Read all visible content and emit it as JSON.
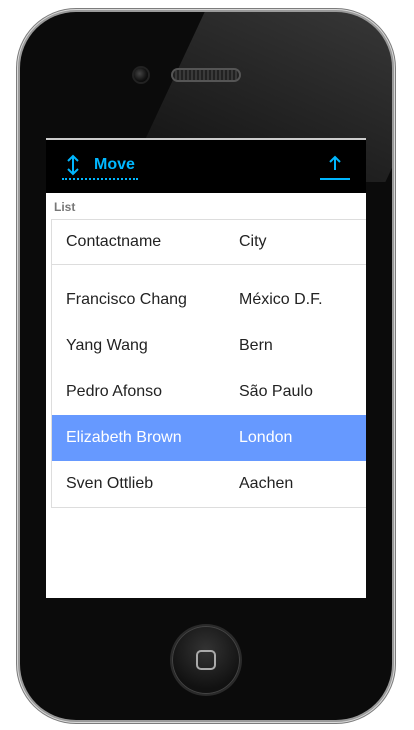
{
  "toolbar": {
    "move_label": "Move",
    "move_icon": "vertical-arrows-icon",
    "up_icon": "arrow-up-icon",
    "accent_color": "#00b7ff"
  },
  "list": {
    "title": "List",
    "columns": [
      "Contactname",
      "City"
    ],
    "rows": [
      {
        "name": "Francisco Chang",
        "city": "México D.F."
      },
      {
        "name": "Yang Wang",
        "city": "Bern"
      },
      {
        "name": "Pedro Afonso",
        "city": "São Paulo"
      },
      {
        "name": "Elizabeth Brown",
        "city": "London"
      },
      {
        "name": "Sven Ottlieb",
        "city": "Aachen"
      }
    ],
    "selected_color": "#6699ff"
  }
}
